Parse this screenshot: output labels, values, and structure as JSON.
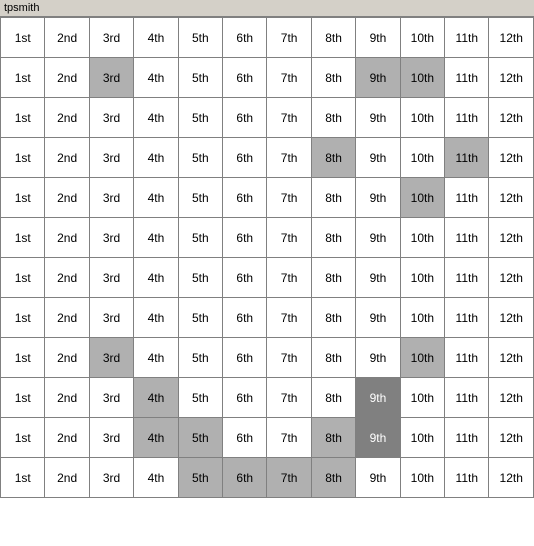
{
  "title": "tpsmith",
  "columns": [
    "1st",
    "2nd",
    "3rd",
    "4th",
    "5th",
    "6th",
    "7th",
    "8th",
    "9th",
    "10th",
    "11th",
    "12th"
  ],
  "rows": [
    {
      "cells": [
        {
          "text": "1st",
          "style": ""
        },
        {
          "text": "2nd",
          "style": ""
        },
        {
          "text": "3rd",
          "style": ""
        },
        {
          "text": "4th",
          "style": ""
        },
        {
          "text": "5th",
          "style": ""
        },
        {
          "text": "6th",
          "style": ""
        },
        {
          "text": "7th",
          "style": ""
        },
        {
          "text": "8th",
          "style": ""
        },
        {
          "text": "9th",
          "style": ""
        },
        {
          "text": "10th",
          "style": ""
        },
        {
          "text": "11th",
          "style": ""
        },
        {
          "text": "12th",
          "style": ""
        }
      ]
    },
    {
      "cells": [
        {
          "text": "1st",
          "style": ""
        },
        {
          "text": "2nd",
          "style": ""
        },
        {
          "text": "3rd",
          "style": "highlight-gray"
        },
        {
          "text": "4th",
          "style": ""
        },
        {
          "text": "5th",
          "style": ""
        },
        {
          "text": "6th",
          "style": ""
        },
        {
          "text": "7th",
          "style": ""
        },
        {
          "text": "8th",
          "style": ""
        },
        {
          "text": "9th",
          "style": "highlight-gray"
        },
        {
          "text": "10th",
          "style": "highlight-gray"
        },
        {
          "text": "11th",
          "style": ""
        },
        {
          "text": "12th",
          "style": ""
        }
      ]
    },
    {
      "cells": [
        {
          "text": "1st",
          "style": ""
        },
        {
          "text": "2nd",
          "style": ""
        },
        {
          "text": "3rd",
          "style": ""
        },
        {
          "text": "4th",
          "style": ""
        },
        {
          "text": "5th",
          "style": ""
        },
        {
          "text": "6th",
          "style": ""
        },
        {
          "text": "7th",
          "style": ""
        },
        {
          "text": "8th",
          "style": ""
        },
        {
          "text": "9th",
          "style": ""
        },
        {
          "text": "10th",
          "style": ""
        },
        {
          "text": "11th",
          "style": ""
        },
        {
          "text": "12th",
          "style": ""
        }
      ]
    },
    {
      "cells": [
        {
          "text": "1st",
          "style": ""
        },
        {
          "text": "2nd",
          "style": ""
        },
        {
          "text": "3rd",
          "style": ""
        },
        {
          "text": "4th",
          "style": ""
        },
        {
          "text": "5th",
          "style": ""
        },
        {
          "text": "6th",
          "style": ""
        },
        {
          "text": "7th",
          "style": ""
        },
        {
          "text": "8th",
          "style": "highlight-gray"
        },
        {
          "text": "9th",
          "style": ""
        },
        {
          "text": "10th",
          "style": ""
        },
        {
          "text": "11th",
          "style": "highlight-gray"
        },
        {
          "text": "12th",
          "style": ""
        }
      ]
    },
    {
      "cells": [
        {
          "text": "1st",
          "style": ""
        },
        {
          "text": "2nd",
          "style": ""
        },
        {
          "text": "3rd",
          "style": ""
        },
        {
          "text": "4th",
          "style": ""
        },
        {
          "text": "5th",
          "style": ""
        },
        {
          "text": "6th",
          "style": ""
        },
        {
          "text": "7th",
          "style": ""
        },
        {
          "text": "8th",
          "style": ""
        },
        {
          "text": "9th",
          "style": ""
        },
        {
          "text": "10th",
          "style": "highlight-gray"
        },
        {
          "text": "11th",
          "style": ""
        },
        {
          "text": "12th",
          "style": ""
        }
      ]
    },
    {
      "cells": [
        {
          "text": "1st",
          "style": ""
        },
        {
          "text": "2nd",
          "style": ""
        },
        {
          "text": "3rd",
          "style": ""
        },
        {
          "text": "4th",
          "style": ""
        },
        {
          "text": "5th",
          "style": ""
        },
        {
          "text": "6th",
          "style": ""
        },
        {
          "text": "7th",
          "style": ""
        },
        {
          "text": "8th",
          "style": ""
        },
        {
          "text": "9th",
          "style": ""
        },
        {
          "text": "10th",
          "style": ""
        },
        {
          "text": "11th",
          "style": ""
        },
        {
          "text": "12th",
          "style": ""
        }
      ]
    },
    {
      "cells": [
        {
          "text": "1st",
          "style": ""
        },
        {
          "text": "2nd",
          "style": ""
        },
        {
          "text": "3rd",
          "style": ""
        },
        {
          "text": "4th",
          "style": ""
        },
        {
          "text": "5th",
          "style": ""
        },
        {
          "text": "6th",
          "style": ""
        },
        {
          "text": "7th",
          "style": ""
        },
        {
          "text": "8th",
          "style": ""
        },
        {
          "text": "9th",
          "style": ""
        },
        {
          "text": "10th",
          "style": ""
        },
        {
          "text": "11th",
          "style": ""
        },
        {
          "text": "12th",
          "style": ""
        }
      ]
    },
    {
      "cells": [
        {
          "text": "1st",
          "style": ""
        },
        {
          "text": "2nd",
          "style": ""
        },
        {
          "text": "3rd",
          "style": ""
        },
        {
          "text": "4th",
          "style": ""
        },
        {
          "text": "5th",
          "style": ""
        },
        {
          "text": "6th",
          "style": ""
        },
        {
          "text": "7th",
          "style": ""
        },
        {
          "text": "8th",
          "style": ""
        },
        {
          "text": "9th",
          "style": ""
        },
        {
          "text": "10th",
          "style": ""
        },
        {
          "text": "11th",
          "style": ""
        },
        {
          "text": "12th",
          "style": ""
        }
      ]
    },
    {
      "cells": [
        {
          "text": "1st",
          "style": ""
        },
        {
          "text": "2nd",
          "style": ""
        },
        {
          "text": "3rd",
          "style": "highlight-gray"
        },
        {
          "text": "4th",
          "style": ""
        },
        {
          "text": "5th",
          "style": ""
        },
        {
          "text": "6th",
          "style": ""
        },
        {
          "text": "7th",
          "style": ""
        },
        {
          "text": "8th",
          "style": ""
        },
        {
          "text": "9th",
          "style": ""
        },
        {
          "text": "10th",
          "style": "highlight-gray"
        },
        {
          "text": "11th",
          "style": ""
        },
        {
          "text": "12th",
          "style": ""
        }
      ]
    },
    {
      "cells": [
        {
          "text": "1st",
          "style": ""
        },
        {
          "text": "2nd",
          "style": ""
        },
        {
          "text": "3rd",
          "style": ""
        },
        {
          "text": "4th",
          "style": "highlight-gray"
        },
        {
          "text": "5th",
          "style": ""
        },
        {
          "text": "6th",
          "style": ""
        },
        {
          "text": "7th",
          "style": ""
        },
        {
          "text": "8th",
          "style": ""
        },
        {
          "text": "9th",
          "style": "highlight-dark"
        },
        {
          "text": "10th",
          "style": ""
        },
        {
          "text": "11th",
          "style": ""
        },
        {
          "text": "12th",
          "style": ""
        }
      ]
    },
    {
      "cells": [
        {
          "text": "1st",
          "style": ""
        },
        {
          "text": "2nd",
          "style": ""
        },
        {
          "text": "3rd",
          "style": ""
        },
        {
          "text": "4th",
          "style": "highlight-gray"
        },
        {
          "text": "5th",
          "style": "highlight-gray"
        },
        {
          "text": "6th",
          "style": ""
        },
        {
          "text": "7th",
          "style": ""
        },
        {
          "text": "8th",
          "style": "highlight-gray"
        },
        {
          "text": "9th",
          "style": "highlight-dark"
        },
        {
          "text": "10th",
          "style": ""
        },
        {
          "text": "11th",
          "style": ""
        },
        {
          "text": "12th",
          "style": ""
        }
      ]
    },
    {
      "cells": [
        {
          "text": "1st",
          "style": ""
        },
        {
          "text": "2nd",
          "style": ""
        },
        {
          "text": "3rd",
          "style": ""
        },
        {
          "text": "4th",
          "style": ""
        },
        {
          "text": "5th",
          "style": "highlight-gray"
        },
        {
          "text": "6th",
          "style": "highlight-gray"
        },
        {
          "text": "7th",
          "style": "highlight-gray"
        },
        {
          "text": "8th",
          "style": "highlight-gray"
        },
        {
          "text": "9th",
          "style": ""
        },
        {
          "text": "10th",
          "style": ""
        },
        {
          "text": "11th",
          "style": ""
        },
        {
          "text": "12th",
          "style": ""
        }
      ]
    }
  ]
}
